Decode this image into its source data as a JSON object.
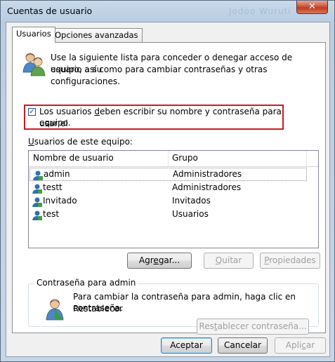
{
  "window": {
    "title": "Cuentas de usuario",
    "bg_ghost_text": "Jodoo Wuruti",
    "close_label": "✕"
  },
  "tabs": [
    {
      "label": "Usuarios",
      "active": true
    },
    {
      "label": "Opciones avanzadas",
      "active": false
    }
  ],
  "intro": {
    "line1": "Use la siguiente lista para conceder o denegar acceso de usuario a su",
    "line2": "equipo, así como para cambiar contraseñas y otras configuraciones."
  },
  "require_login": {
    "checked": true,
    "check_glyph": "✓",
    "line1_pre": "Los usuarios ",
    "line1_mnemonic": "d",
    "line1_post": "eben escribir su nombre y contraseña para usar el",
    "line2": "equipo."
  },
  "users_label": {
    "mnemonic": "U",
    "rest": "suarios de este equipo:"
  },
  "table": {
    "columns": [
      "Nombre de usuario",
      "Grupo"
    ],
    "rows": [
      {
        "name": "admin",
        "group": "Administradores",
        "selected": true
      },
      {
        "name": "testt",
        "group": "Administradores",
        "selected": false
      },
      {
        "name": "Invitado",
        "group": "Invitados",
        "selected": false
      },
      {
        "name": "test",
        "group": "Usuarios",
        "selected": false
      }
    ]
  },
  "buttons": {
    "add": {
      "pre": "Agr",
      "mnemonic": "e",
      "post": "gar..."
    },
    "remove": {
      "pre": "",
      "mnemonic": "Q",
      "post": "uitar"
    },
    "properties": {
      "pre": "",
      "mnemonic": "P",
      "post": "ropiedades"
    }
  },
  "password_group": {
    "title": "Contraseña para admin",
    "line1": "Para cambiar la contraseña para admin, haga clic en Restablecer",
    "line2": "contraseña.",
    "reset_button": {
      "pre": "Res",
      "mnemonic": "t",
      "post": "ablecer contraseña..."
    }
  },
  "dialog_buttons": {
    "ok": "Aceptar",
    "cancel": "Cancelar",
    "apply": {
      "pre": "Apli",
      "mnemonic": "c",
      "post": "ar"
    }
  },
  "colors": {
    "highlight_border": "#d01921",
    "close_button": "#c03a22"
  }
}
